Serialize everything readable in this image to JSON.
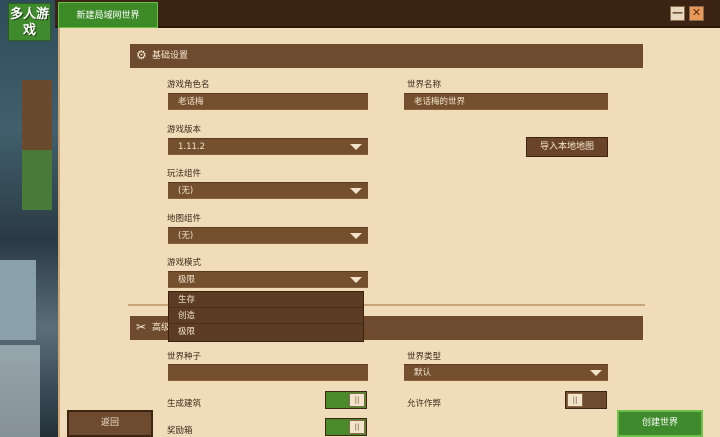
{
  "app": {
    "logo_text": "多人游戏",
    "tab_label": "新建局域网世界",
    "minimize_glyph": "—",
    "close_glyph": "✕"
  },
  "basic": {
    "section_title": "基础设置",
    "role_label": "游戏角色名",
    "role_value": "老话梅",
    "world_name_label": "世界名称",
    "world_name_value": "老话梅的世界",
    "version_label": "游戏版本",
    "version_value": "1.11.2",
    "import_button": "导入本地地图",
    "gameplay_addon_label": "玩法组件",
    "gameplay_addon_value": "(无)",
    "map_addon_label": "地图组件",
    "map_addon_value": "(无)",
    "mode_label": "游戏模式",
    "mode_value": "极限",
    "mode_options": [
      "生存",
      "创造",
      "极限"
    ]
  },
  "advanced": {
    "section_title": "高级设置",
    "seed_label": "世界种子",
    "seed_value": "",
    "world_type_label": "世界类型",
    "world_type_value": "默认",
    "structures_label": "生成建筑",
    "structures_on": true,
    "cheats_label": "允许作弊",
    "cheats_on": false,
    "bonus_chest_label": "奖励箱"
  },
  "footer": {
    "back_button": "返回",
    "create_button": "创建世界"
  },
  "colors": {
    "accent_green": "#3f8a2c",
    "panel_bg": "#f0dcb8",
    "field_brown": "#74502f",
    "header_brown": "#6e4a2e"
  },
  "icons": {
    "basic_section": "gear-icon",
    "advanced_section": "tools-icon",
    "dropdown": "chevron-down-icon"
  }
}
